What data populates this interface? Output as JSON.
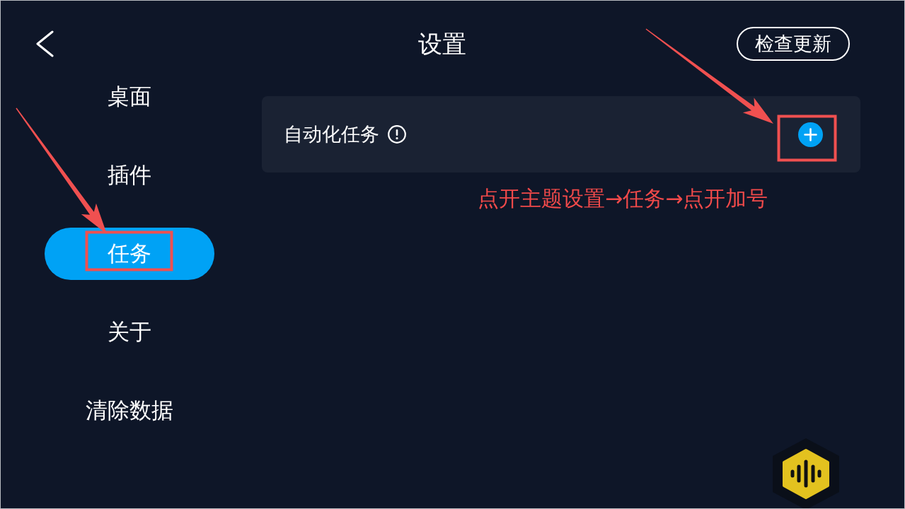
{
  "header": {
    "title": "设置",
    "update_button": "检查更新"
  },
  "sidebar": {
    "items": [
      {
        "label": "桌面",
        "selected": false
      },
      {
        "label": "插件",
        "selected": false
      },
      {
        "label": "任务",
        "selected": true
      },
      {
        "label": "关于",
        "selected": false
      },
      {
        "label": "清除数据",
        "selected": false
      }
    ]
  },
  "card": {
    "label": "自动化任务"
  },
  "annotation": {
    "caption": "点开主题设置→任务→点开加号"
  }
}
